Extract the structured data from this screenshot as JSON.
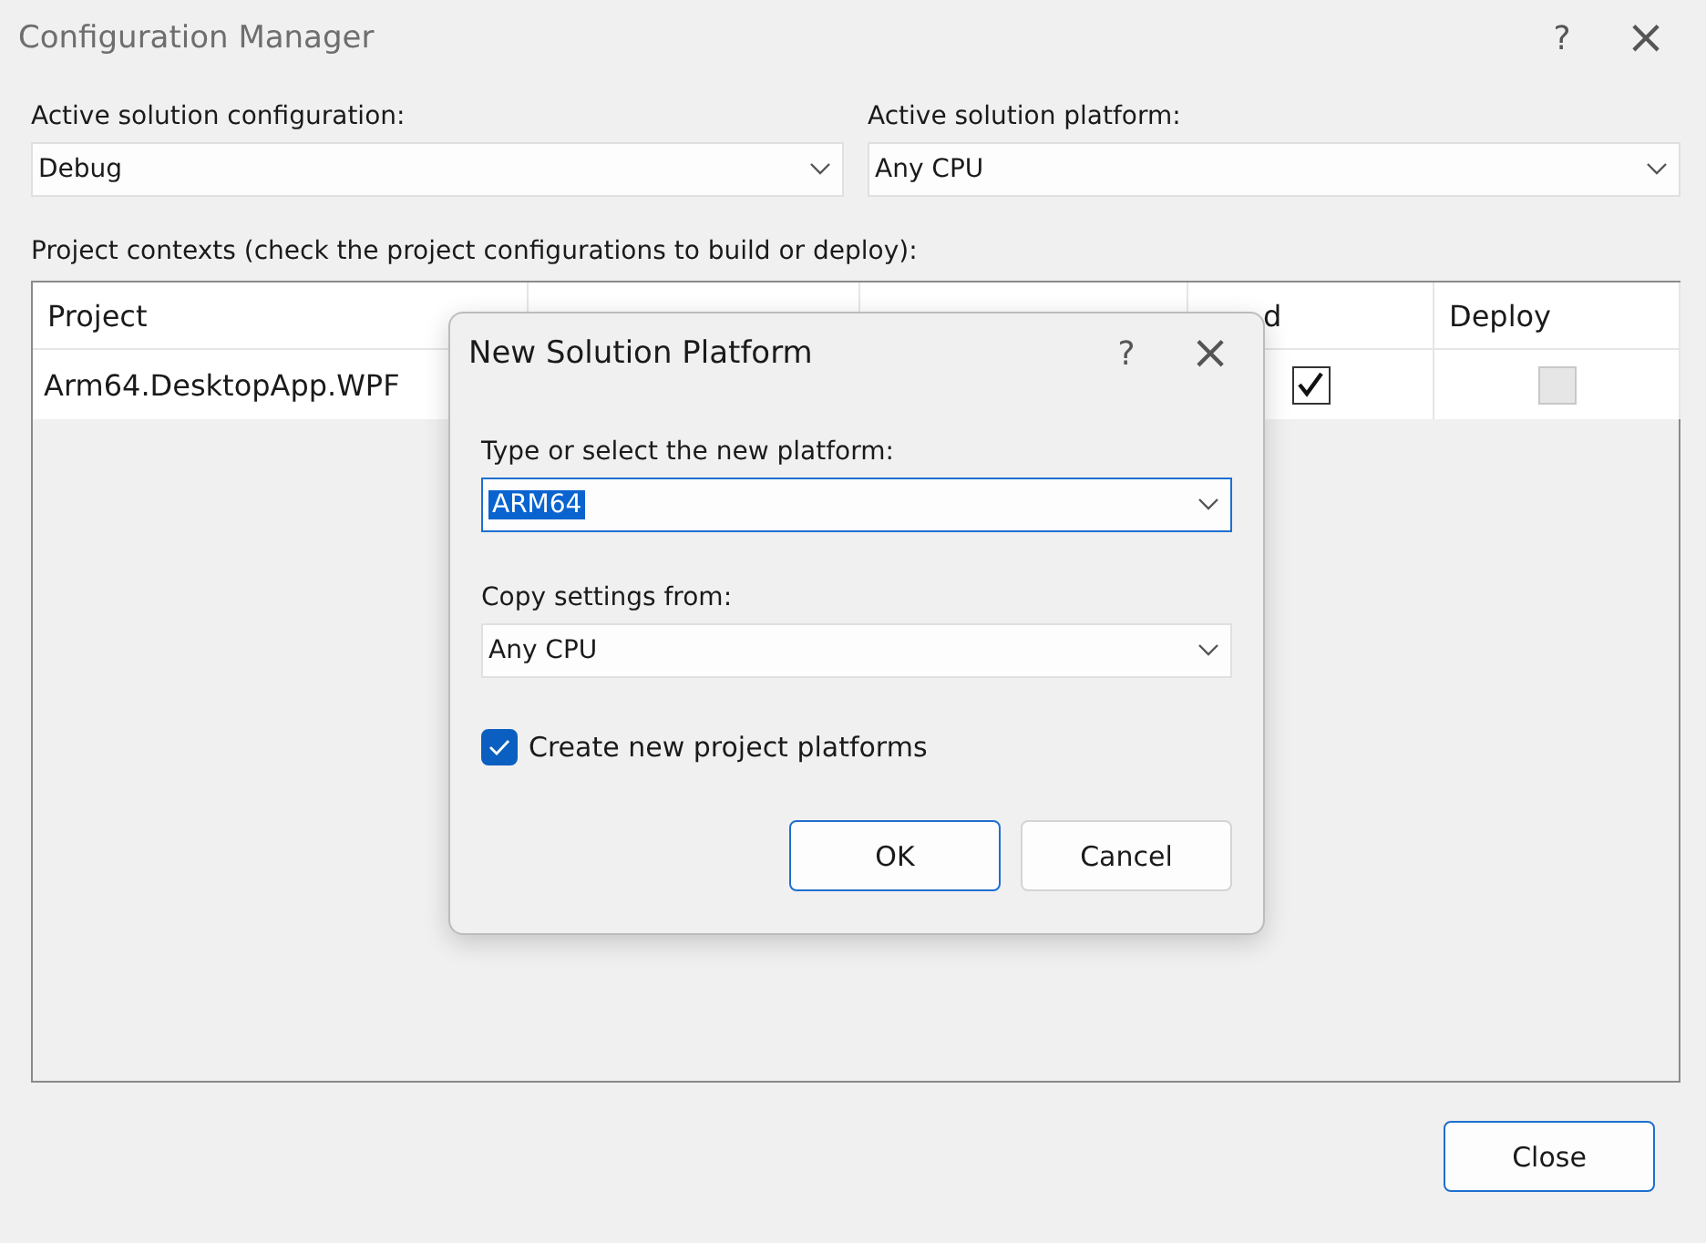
{
  "window": {
    "title": "Configuration Manager",
    "help": "?",
    "close": "×"
  },
  "configuration": {
    "label": "Active solution configuration:",
    "value": "Debug"
  },
  "platform": {
    "label": "Active solution platform:",
    "value": "Any CPU"
  },
  "contexts_label": "Project contexts (check the project configurations to build or deploy):",
  "table": {
    "columns": [
      {
        "label": "Project"
      },
      {},
      {},
      {
        "label": "d"
      },
      {
        "label": "Deploy"
      }
    ],
    "rows": [
      {
        "project": "Arm64.DesktopApp.WPF",
        "build": true,
        "deploy": false,
        "deploy_disabled": true
      }
    ]
  },
  "dialog": {
    "title": "New Solution Platform",
    "help": "?",
    "close": "×",
    "platform_label": "Type or select the new platform:",
    "platform_value": "ARM64",
    "platform_selected": true,
    "copy_label": "Copy settings from:",
    "copy_value": "Any CPU",
    "create_label": "Create new project platforms",
    "create_checked": true,
    "buttons": [
      {
        "label": "OK",
        "default": true
      },
      {
        "label": "Cancel",
        "default": false
      }
    ]
  },
  "close_button": "Close"
}
